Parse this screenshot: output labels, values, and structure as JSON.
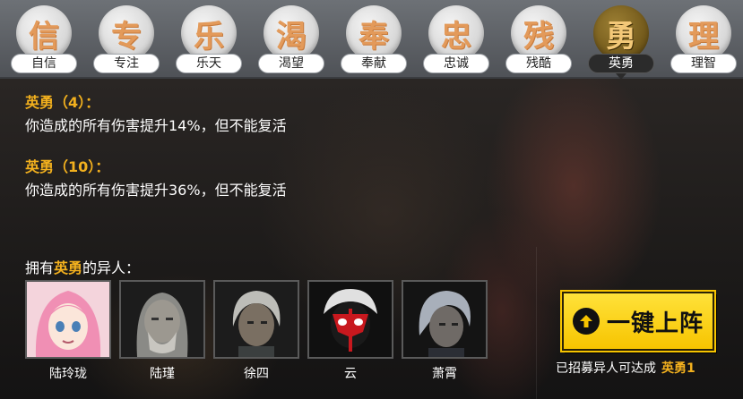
{
  "tabs": [
    {
      "glyph": "信",
      "label": "自信",
      "active": false
    },
    {
      "glyph": "专",
      "label": "专注",
      "active": false
    },
    {
      "glyph": "乐",
      "label": "乐天",
      "active": false
    },
    {
      "glyph": "渴",
      "label": "渴望",
      "active": false
    },
    {
      "glyph": "奉",
      "label": "奉献",
      "active": false
    },
    {
      "glyph": "忠",
      "label": "忠诚",
      "active": false
    },
    {
      "glyph": "残",
      "label": "残酷",
      "active": false
    },
    {
      "glyph": "勇",
      "label": "英勇",
      "active": true
    },
    {
      "glyph": "理",
      "label": "理智",
      "active": false
    }
  ],
  "effects": [
    {
      "title": "英勇（4）：",
      "desc": "你造成的所有伤害提升14%，但不能复活"
    },
    {
      "title": "英勇（10）：",
      "desc": "你造成的所有伤害提升36%，但不能复活"
    }
  ],
  "owners": {
    "prefix": "拥有",
    "trait": "英勇",
    "suffix": "的异人："
  },
  "characters": [
    {
      "name": "陆玲珑",
      "icon": "portrait-pink-hair-girl"
    },
    {
      "name": "陆瑾",
      "icon": "portrait-grey-old-man"
    },
    {
      "name": "徐四",
      "icon": "portrait-grey-hair-man"
    },
    {
      "name": "云",
      "icon": "portrait-red-mask-man"
    },
    {
      "name": "萧霄",
      "icon": "portrait-silver-hair-man"
    }
  ],
  "recruit_button": {
    "label": "一键上阵",
    "icon": "arrow-up-icon"
  },
  "reach": {
    "text": "已招募异人可达成",
    "highlight": "英勇1"
  },
  "colors": {
    "accent": "#f2b01e",
    "button": "#f7c400",
    "tab_label": "#222222"
  }
}
